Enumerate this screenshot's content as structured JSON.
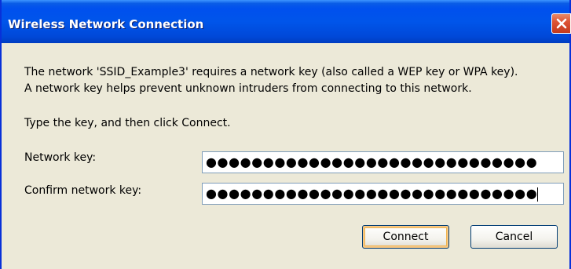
{
  "dialog": {
    "title": "Wireless Network Connection",
    "close_glyph": "✕",
    "message_line1": "The network 'SSID_Example3' requires a network key (also called a WEP key or WPA key).",
    "message_line2": "A network key helps prevent unknown intruders from connecting to this network.",
    "instruction": "Type the key, and then click Connect.",
    "network_key": {
      "label": "Network key:",
      "value": "●●●●●●●●●●●●●●●●●●●●●●●●●●●●●"
    },
    "confirm_key": {
      "label": "Confirm network key:",
      "value": "●●●●●●●●●●●●●●●●●●●●●●●●●●●●●"
    },
    "connect_label": "Connect",
    "cancel_label": "Cancel"
  },
  "colors": {
    "titlebar": "#0055ea",
    "close_button": "#dd5435",
    "dialog_bg": "#ece9d8"
  }
}
